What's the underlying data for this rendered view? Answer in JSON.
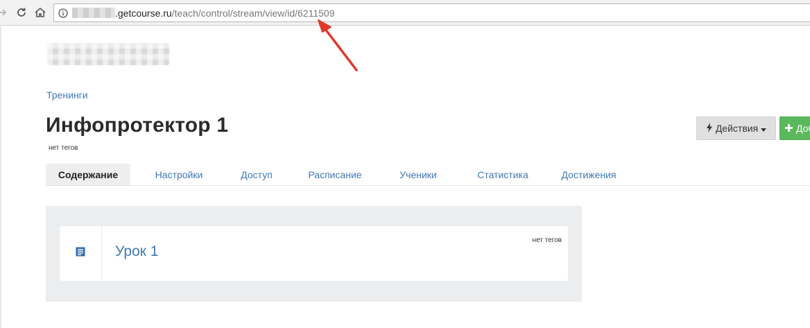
{
  "browser": {
    "url_domain": ".getcourse.ru",
    "url_path": "/teach/control/stream/view/id/6211509"
  },
  "breadcrumb": {
    "label": "Тренинги"
  },
  "page": {
    "title": "Инфопротектор 1",
    "tags": "нет тегов"
  },
  "toolbar": {
    "actions_label": "Действия",
    "add_label": "Добавить"
  },
  "tabs": [
    {
      "label": "Содержание",
      "active": true
    },
    {
      "label": "Настройки"
    },
    {
      "label": "Доступ"
    },
    {
      "label": "Расписание"
    },
    {
      "label": "Ученики"
    },
    {
      "label": "Статистика"
    },
    {
      "label": "Достижения"
    }
  ],
  "lessons": [
    {
      "title": "Урок 1",
      "tags": "нет тегов",
      "icon": "lesson-list-icon"
    }
  ],
  "colors": {
    "link": "#3f78b5",
    "success": "#5cb85c",
    "arrow": "#e0392b"
  }
}
